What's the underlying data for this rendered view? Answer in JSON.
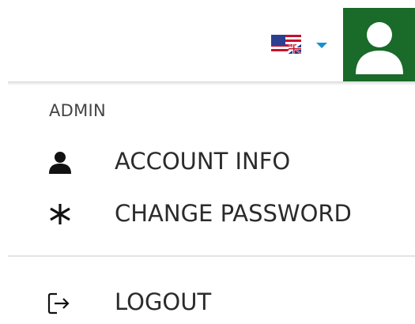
{
  "header": {
    "language_flag": "us-uk-flag-icon",
    "language_caret": "caret-down-icon",
    "user_icon": "user-avatar-icon",
    "colors": {
      "avatar_bg": "#1a6a29",
      "caret": "#1a8fcf"
    }
  },
  "menu": {
    "section_label": "ADMIN",
    "items": [
      {
        "label": "ACCOUNT INFO",
        "icon": "person-icon"
      },
      {
        "label": "CHANGE PASSWORD",
        "icon": "asterisk-icon"
      }
    ],
    "logout": {
      "label": "LOGOUT",
      "icon": "logout-icon"
    }
  }
}
